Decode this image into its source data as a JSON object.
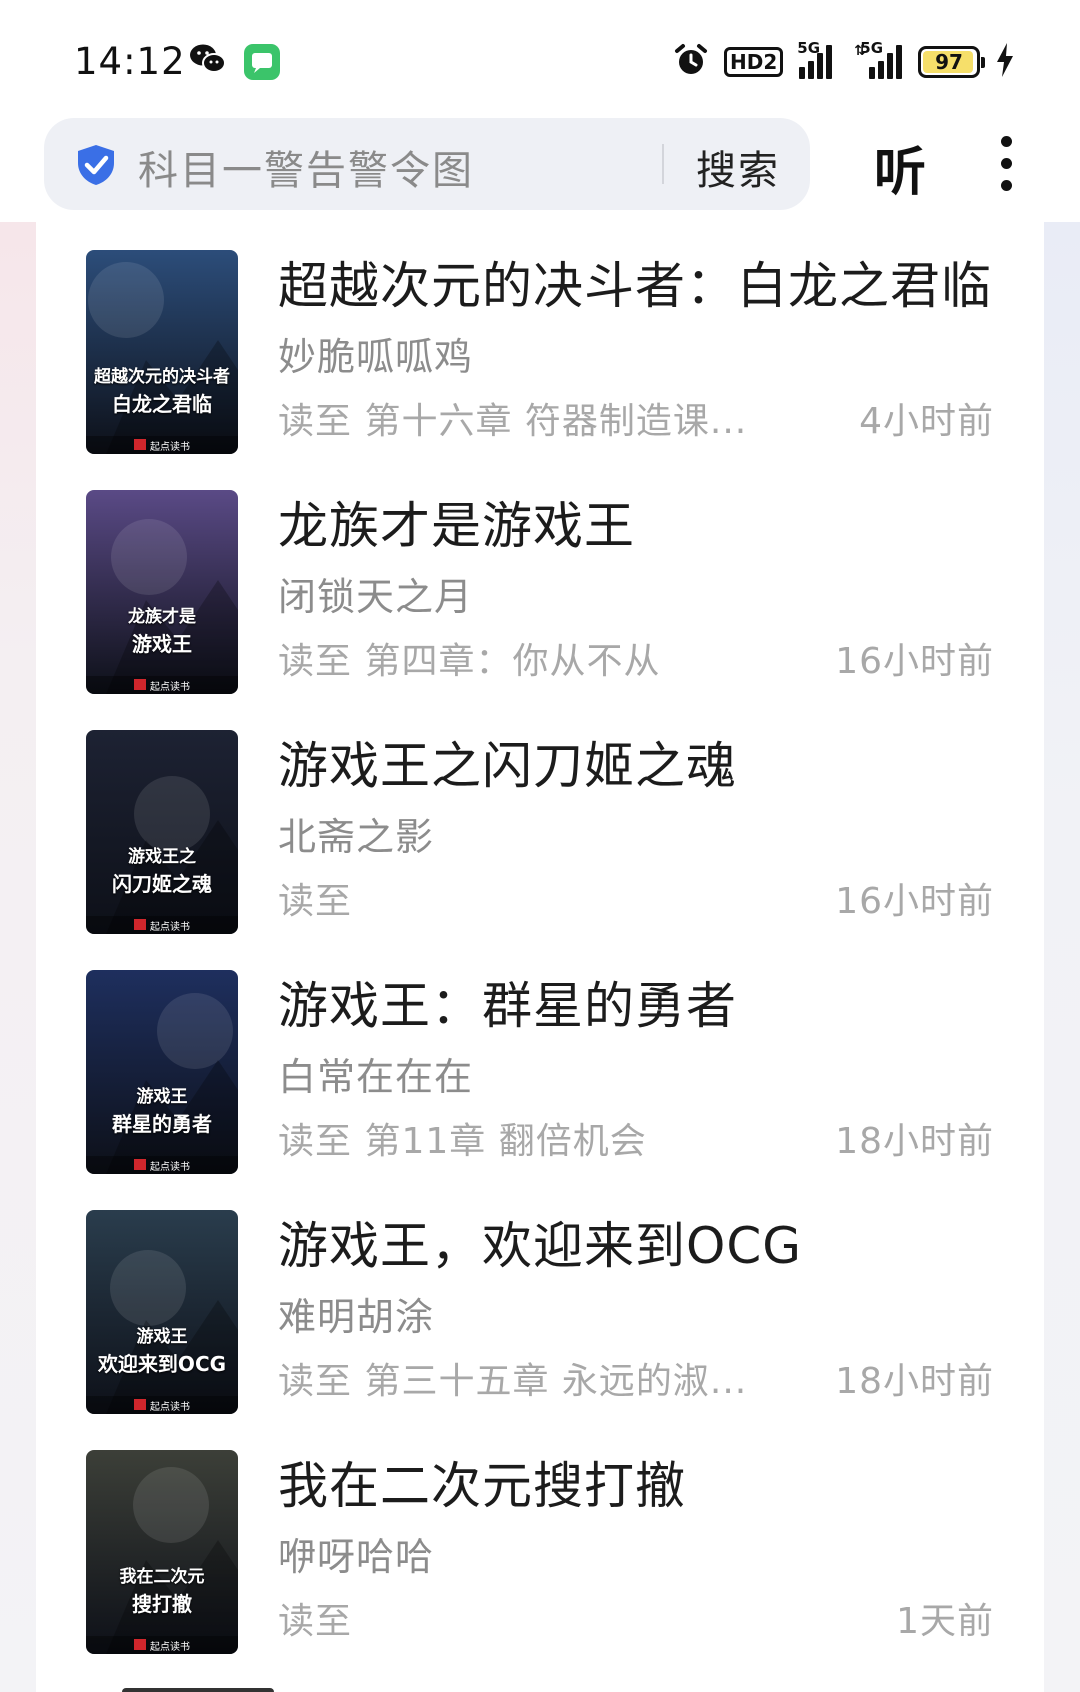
{
  "status_bar": {
    "time": "14:12",
    "icons": [
      "wechat-icon",
      "messages-icon",
      "alarm-icon",
      "hd-voice-icon",
      "signal-5g-icon",
      "signal-5g-icon",
      "battery-icon",
      "charging-icon"
    ],
    "hd_label": "HD2",
    "network_1": "5G",
    "network_2": "5G",
    "battery_percent": "97",
    "battery_level": 0.97,
    "battery_color": "#f6df6a"
  },
  "header": {
    "search_placeholder": "科目一警告警令图",
    "search_button": "搜索",
    "listen_button": "听",
    "shield_color": "#3a6fe6"
  },
  "books": [
    {
      "title": "超越次元的决斗者：白龙之君临",
      "author": "妙脆呱呱鸡",
      "progress": "读至 第十六章 符器制造课...",
      "time": "4小时前",
      "cover_title": "超越次元的决斗者",
      "cover_subtitle": "白龙之君临",
      "cover_theme": "#2c4d7a"
    },
    {
      "title": "龙族才是游戏王",
      "author": "闭锁天之月",
      "progress": "读至 第四章：你从不从",
      "time": "16小时前",
      "cover_title": "龙族才是",
      "cover_subtitle": "游戏王",
      "cover_theme": "#5a4a86"
    },
    {
      "title": "游戏王之闪刀姬之魂",
      "author": "北斋之影",
      "progress": "读至",
      "time": "16小时前",
      "cover_title": "游戏王之",
      "cover_subtitle": "闪刀姬之魂",
      "cover_theme": "#1d2233"
    },
    {
      "title": "游戏王：群星的勇者",
      "author": "白常在在在",
      "progress": "读至 第11章 翻倍机会",
      "time": "18小时前",
      "cover_title": "游戏王",
      "cover_subtitle": "群星的勇者",
      "cover_theme": "#1e2f5e"
    },
    {
      "title": "游戏王，欢迎来到OCG",
      "author": "难明胡涂",
      "progress": "读至 第三十五章 永远的淑...",
      "time": "18小时前",
      "cover_title": "游戏王",
      "cover_subtitle": "欢迎来到OCG",
      "cover_theme": "#2a3d4d"
    },
    {
      "title": "我在二次元搜打撤",
      "author": "咿呀哈哈",
      "progress": "读至",
      "time": "1天前",
      "cover_title": "我在二次元",
      "cover_subtitle": "搜打撤",
      "cover_theme": "#3c3f38"
    }
  ],
  "cover_publisher": "起点读书"
}
